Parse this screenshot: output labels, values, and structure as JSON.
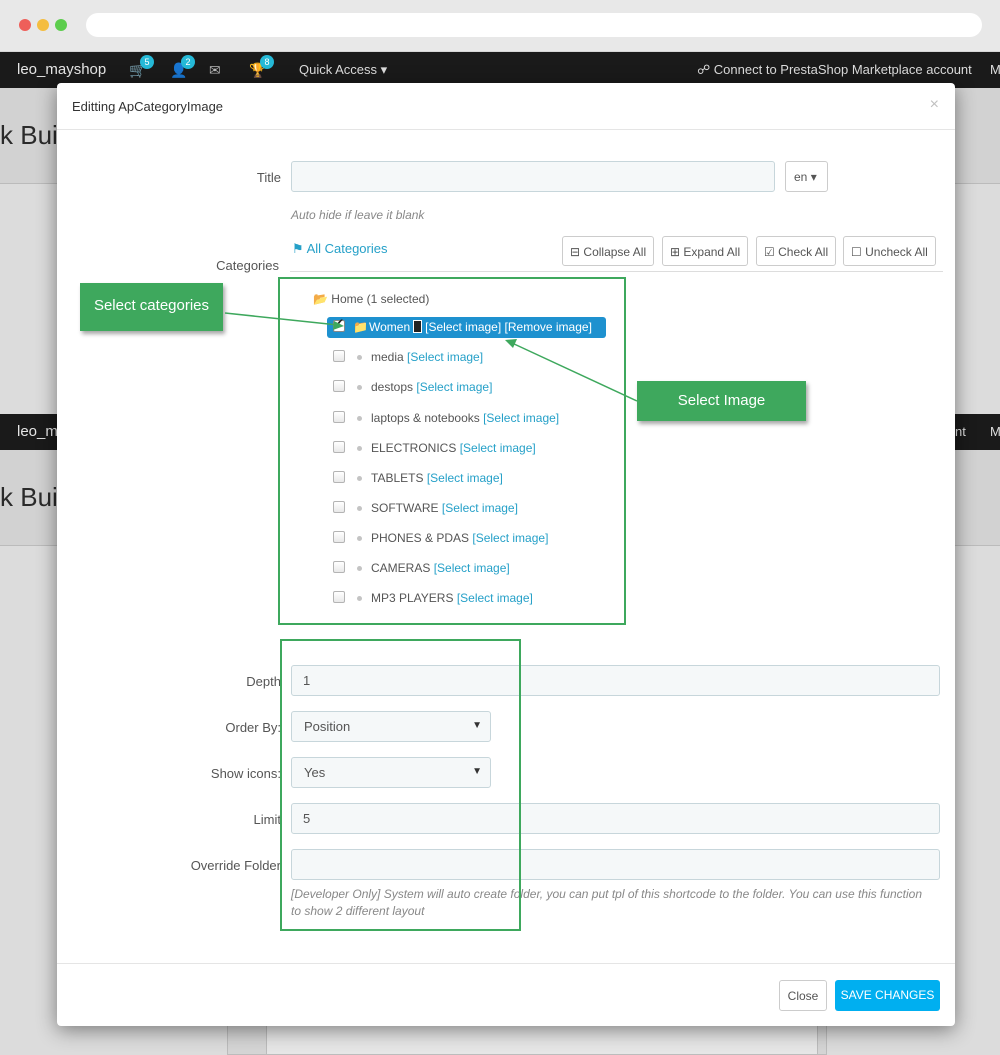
{
  "topbar": {
    "shop_name": "leo_mayshop",
    "cart_count": "5",
    "customers_count": "2",
    "trophy_count": "8",
    "quick_access": "Quick Access",
    "connect": "Connect to PrestaShop Marketplace account",
    "more": "M"
  },
  "bg": {
    "builder": "k Bui",
    "shop_name_2": "leo_m",
    "nt": "nt"
  },
  "modal": {
    "title": "Editting ApCategoryImage",
    "close_symbol": "×",
    "title_label": "Title",
    "title_value": "",
    "lang": "en",
    "title_hint": "Auto hide if leave it blank",
    "categories_label": "Categories",
    "all_categories": "All Categories",
    "tree_buttons": {
      "collapse": "Collapse All",
      "expand": "Expand All",
      "check": "Check All",
      "uncheck": "Uncheck All"
    },
    "home": "Home (1 selected)",
    "selected_row": {
      "name": "Women",
      "select_link": "[Select image]",
      "remove_link": "[Remove image]"
    },
    "select_link": "[Select image]",
    "categories": [
      "media",
      "destops",
      "laptops & notebooks",
      "ELECTRONICS",
      "TABLETS",
      "SOFTWARE",
      "PHONES & PDAS",
      "CAMERAS",
      "MP3 PLAYERS"
    ],
    "depth_label": "Depth",
    "depth_value": "1",
    "order_label": "Order By:",
    "order_value": "Position",
    "icons_label": "Show icons:",
    "icons_value": "Yes",
    "limit_label": "Limit",
    "limit_value": "5",
    "override_label": "Override Folder",
    "override_value": "",
    "override_hint": "[Developer Only] System will auto create folder, you can put tpl of this shortcode to the folder. You can use this function to show 2 different layout",
    "close_button": "Close",
    "save_button": "SAVE CHANGES"
  },
  "annotations": {
    "select_categories": "Select categories",
    "select_image": "Select Image",
    "color": "#3ea85d"
  },
  "colors": {
    "accent": "#00aff0",
    "selected_row": "#1e91cf",
    "link": "#25a0c8"
  }
}
